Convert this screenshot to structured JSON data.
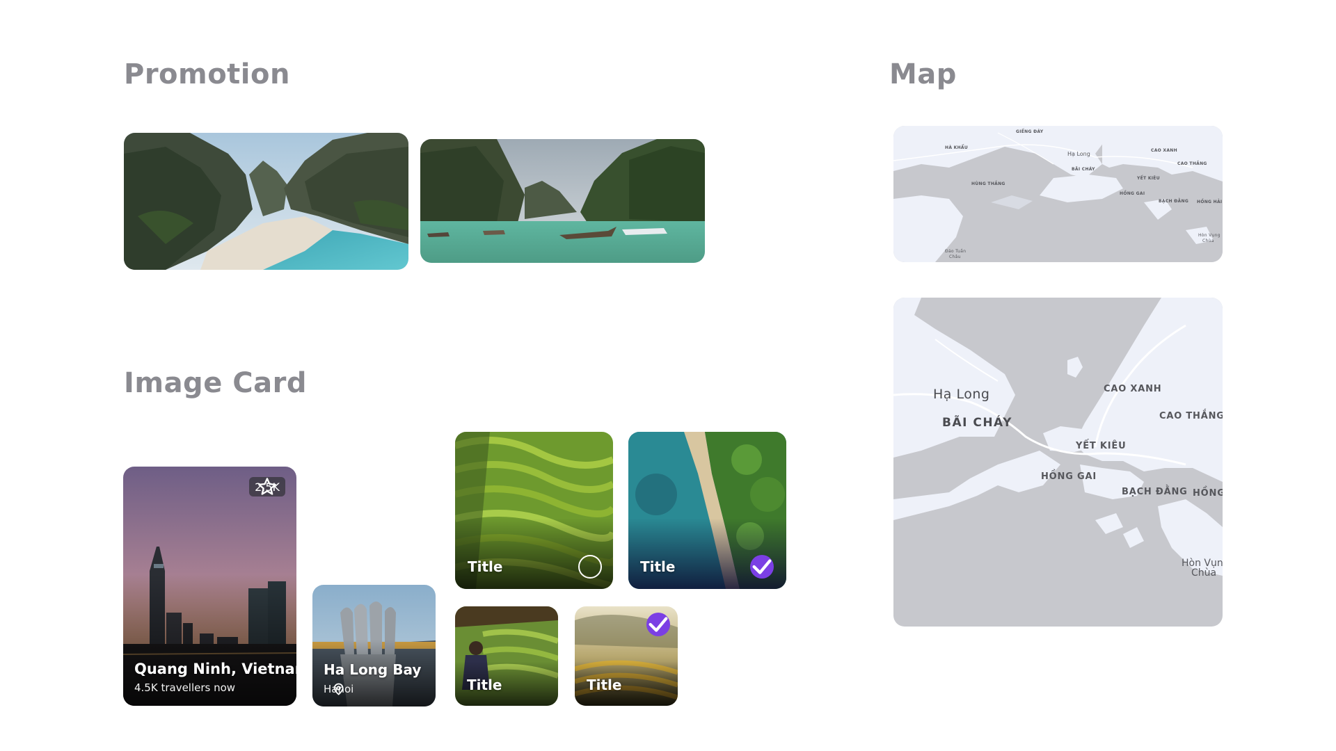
{
  "sections": {
    "promotion": "Promotion",
    "map": "Map",
    "image_card": "Image Card"
  },
  "cards": {
    "city": {
      "rating": "2.5K",
      "title": "Quang Ninh, Vietnam",
      "subtitle": "4.5K travellers now",
      "icon": "star-icon"
    },
    "place": {
      "title": "Ha Long Bay",
      "location": "Hanoi",
      "icon": "location-pin-icon"
    },
    "select_cards": [
      {
        "title": "Title",
        "selected": false
      },
      {
        "title": "Title",
        "selected": true
      }
    ],
    "small_cards": [
      {
        "title": "Title",
        "selected": false
      },
      {
        "title": "Title",
        "selected": true
      }
    ]
  },
  "map_small_labels": {
    "giengday": "GIẾNG ĐÁY",
    "hakhau": "HÀ KHẨU",
    "halong": "Hạ Long",
    "baichay": "BÃI CHÁY",
    "caoxanh": "CAO XANH",
    "caothang": "CAO THẮNG",
    "hungthang": "HÙNG THẮNG",
    "yetkieu": "YẾT KIÊU",
    "honggai": "HỒNG GAI",
    "bachdang": "BẠCH ĐẰNG",
    "honghai": "HỒNG HẢI",
    "hon_vung_1": "Hòn Vụng",
    "hon_vung_2": "Chùa",
    "dao_tuan_1": "Đảo Tuần",
    "dao_tuan_2": "Châu"
  },
  "map_large_labels": {
    "halong": "Hạ Long",
    "baichay": "BÃI CHÁY",
    "caoxanh": "CAO XANH",
    "caothang": "CAO THẮNG",
    "yetkieu": "YẾT KIÊU",
    "honggai": "HỒNG GAI",
    "bachdang": "BẠCH ĐẰNG",
    "hong": "HỒNG",
    "hon_vung_1": "Hòn Vụng",
    "hon_vung_2": "Chùa"
  },
  "colors": {
    "accent": "#7b3fe4",
    "heading": "#8a8a90",
    "map_water": "#c7c8cd",
    "map_land": "#eef1f9"
  }
}
